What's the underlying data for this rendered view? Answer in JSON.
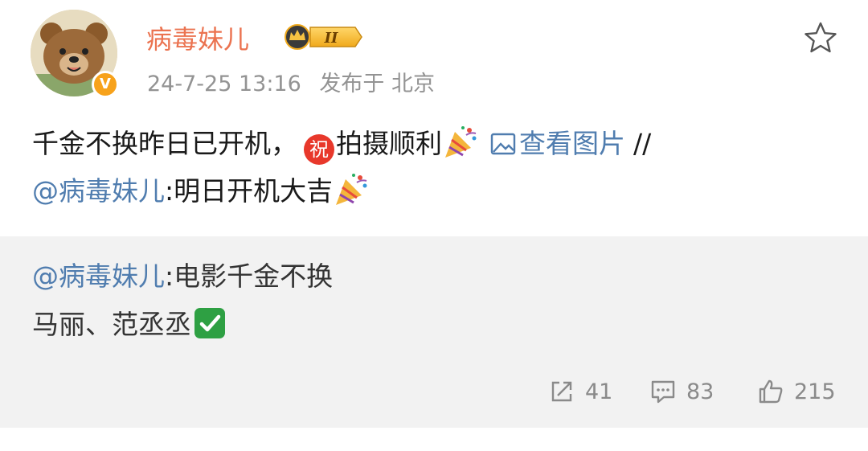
{
  "header": {
    "username": "病毒妹儿",
    "member_level": "II",
    "timestamp": "24-7-25 13:16",
    "source": "发布于 北京",
    "verified_badge": "V",
    "favorite_icon": "star-outline-icon"
  },
  "post": {
    "line1_text": "千金不换昨日已开机，",
    "zhu_emoji": "祝",
    "line1_text2": "拍摄顺利",
    "view_image_label": "查看图片",
    "separator": "//",
    "mention": "@病毒妹儿",
    "line2_text": ":明日开机大吉"
  },
  "repost": {
    "mention": "@病毒妹儿",
    "line1_text": ":电影千金不换",
    "line2_text": "马丽、范丞丞"
  },
  "actions": {
    "share_count": "41",
    "comment_count": "83",
    "like_count": "215"
  },
  "colors": {
    "username": "#eb7350",
    "link": "#507daf",
    "meta": "#939393",
    "repost_bg": "#f2f2f2",
    "verified": "#f7a21b"
  }
}
